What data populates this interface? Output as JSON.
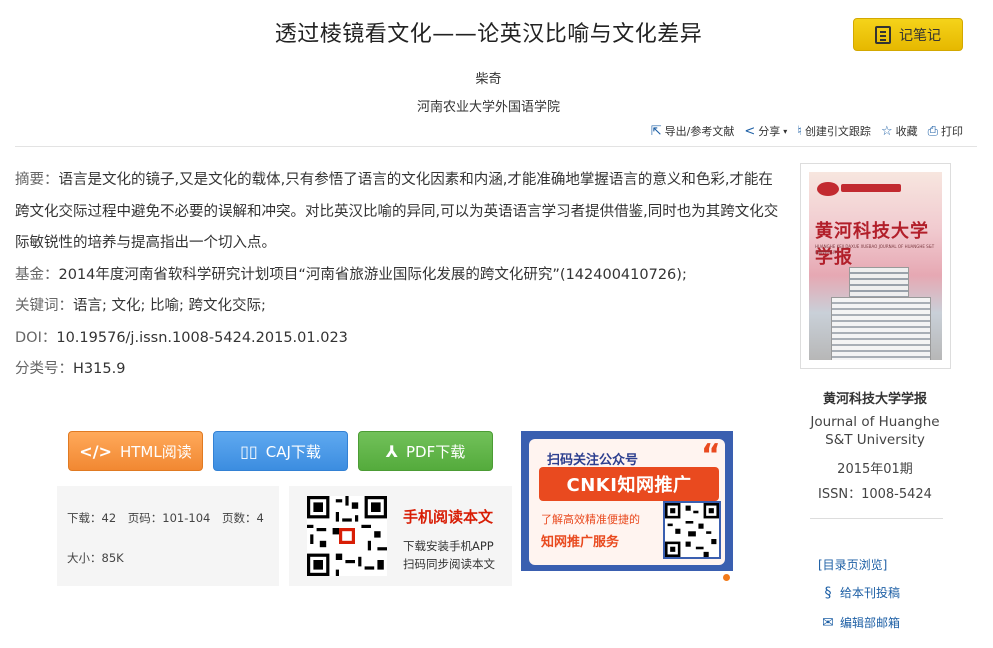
{
  "article": {
    "title": "透过棱镜看文化——论英汉比喻与文化差异",
    "author": "柴奇",
    "affiliation": "河南农业大学外国语学院"
  },
  "note_button": {
    "label": "记笔记"
  },
  "toolbar": {
    "export": "导出/参考文献",
    "share": "分享",
    "track": "创建引文跟踪",
    "favorite": "收藏",
    "print": "打印"
  },
  "meta": {
    "abstract_label": "摘要：",
    "abstract": "语言是文化的镜子,又是文化的载体,只有参悟了语言的文化因素和内涵,才能准确地掌握语言的意义和色彩,才能在跨文化交际过程中避免不必要的误解和冲突。对比英汉比喻的异同,可以为英语语言学习者提供借鉴,同时也为其跨文化交际敏锐性的培养与提高指出一个切入点。",
    "fund_label": "基金：",
    "fund": "2014年度河南省软科学研究计划项目“河南省旅游业国际化发展的跨文化研究”(142400410726);",
    "keywords_label": "关键词：",
    "keywords": "语言; 文化; 比喻; 跨文化交际;",
    "doi_label": "DOI：",
    "doi": "10.19576/j.issn.1008-5424.2015.01.023",
    "class_label": "分类号：",
    "class": "H315.9"
  },
  "downloads": {
    "html": "HTML阅读",
    "caj": "CAJ下载",
    "pdf": "PDF下载"
  },
  "stats": {
    "downloads": "下载：42",
    "pages": "页码：101-104",
    "page_count": "页数：4",
    "size": "大小：85K"
  },
  "mobile": {
    "title": "手机阅读本文",
    "line1": "下载安装手机APP",
    "line2": "扫码同步阅读本文"
  },
  "promo": {
    "line1": "扫码关注公众号",
    "banner": "CNKI知网推广",
    "line2": "了解高效精准便捷的",
    "line3": "知网推广服务"
  },
  "journal": {
    "cover_title": "黄河科技大学学报",
    "cover_sub": "HUANGHE KEJI DAXUE XUEBAO JOURNAL OF HUANGHE S&T UNIVERSITY",
    "name": "黄河科技大学学报",
    "name_en": "Journal of Huanghe S&T University",
    "issue": "2015年01期",
    "issn": "ISSN：1008-5424",
    "toc": "[目录页浏览]",
    "submit": "给本刊投稿",
    "editorial": "编辑部邮箱"
  },
  "colors": {
    "link": "#1d5fa5",
    "html_btn": "#f18832",
    "caj_btn": "#3c8de0",
    "pdf_btn": "#54ab3c",
    "note_btn": "#e6b800",
    "promo_accent": "#e94a1f"
  }
}
